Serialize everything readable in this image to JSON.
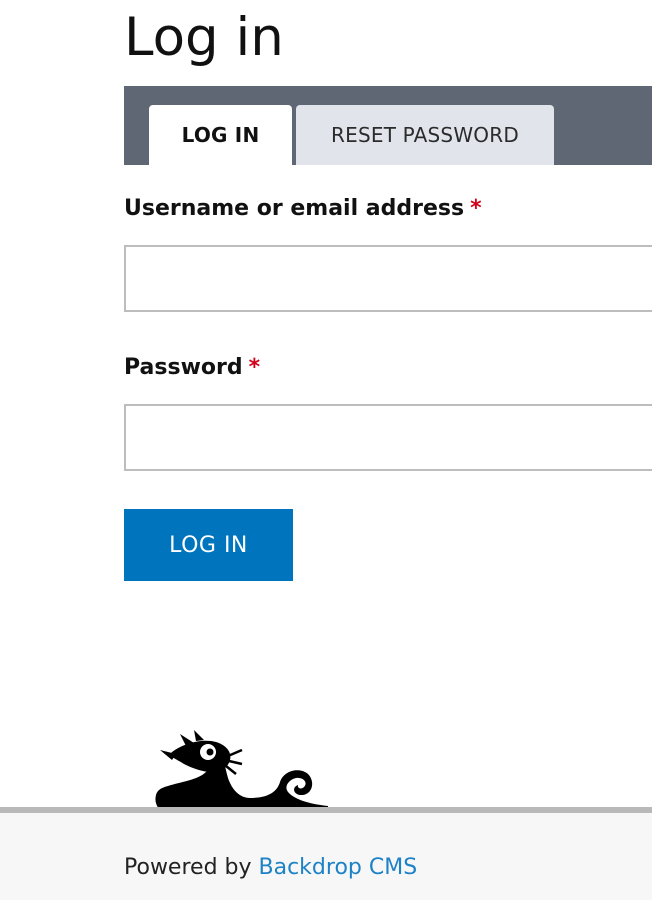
{
  "page": {
    "title": "Log in"
  },
  "tabs": [
    {
      "label": "LOG IN",
      "active": true
    },
    {
      "label": "RESET PASSWORD",
      "active": false
    }
  ],
  "form": {
    "username": {
      "label": "Username or email address",
      "required_marker": "*",
      "value": "",
      "placeholder": ""
    },
    "password": {
      "label": "Password",
      "required_marker": "*",
      "value": "",
      "placeholder": ""
    },
    "submit_label": "LOG IN"
  },
  "footer": {
    "prefix": "Powered by",
    "link_text": "Backdrop CMS"
  },
  "colors": {
    "primary_button": "#0074bd",
    "tabs_bar": "#5f6774",
    "link": "#1d82c6",
    "required": "#d0021b"
  },
  "icons": {
    "mascot": "backdrop-dragon-logo"
  }
}
